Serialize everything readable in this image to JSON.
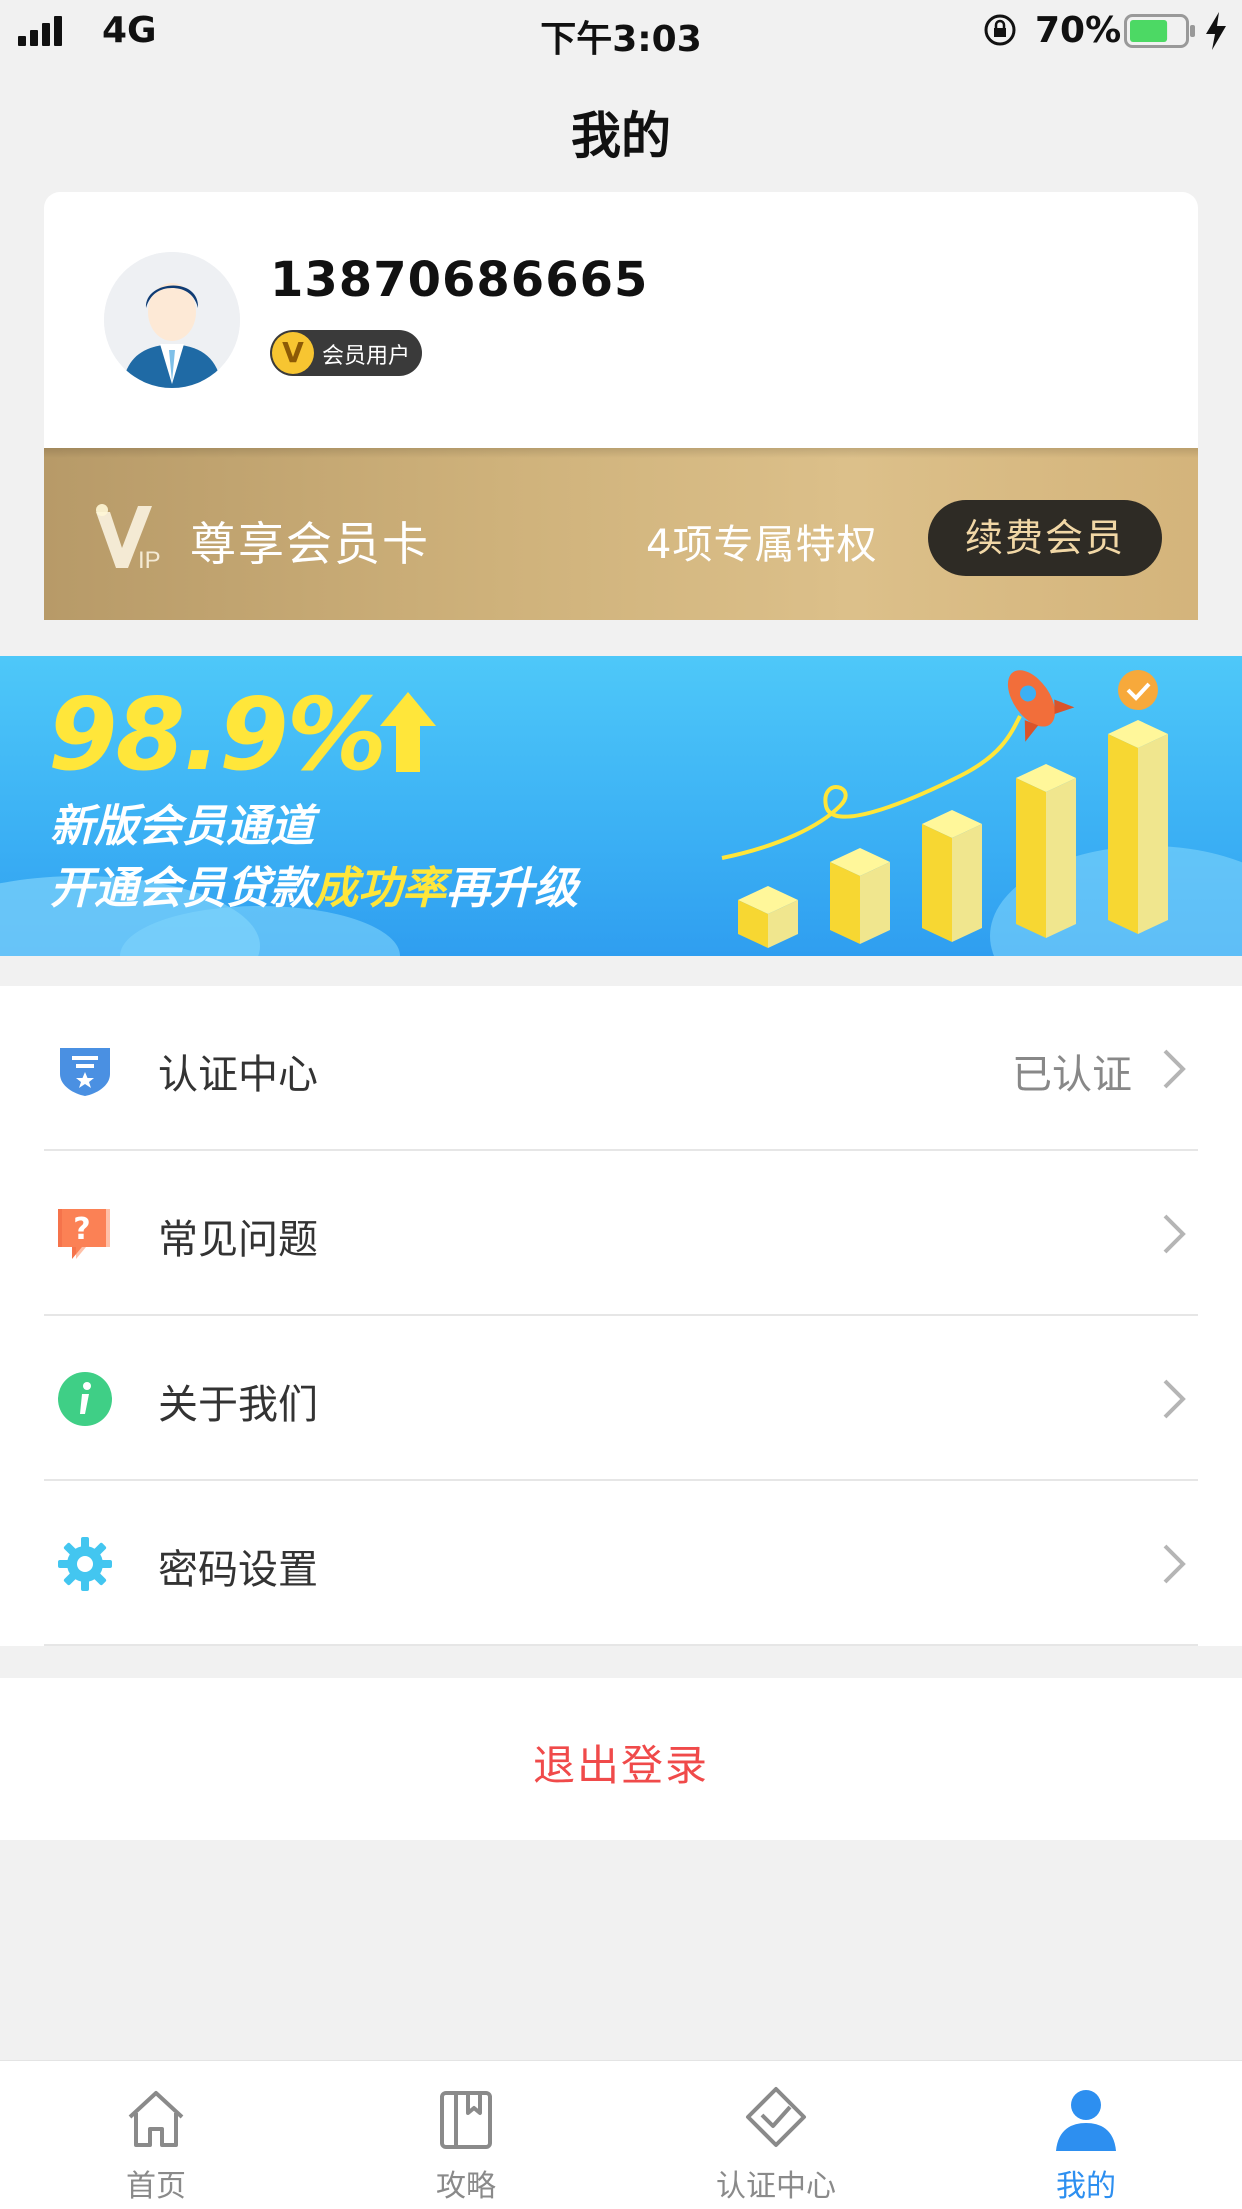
{
  "status_bar": {
    "network": "4G",
    "time": "下午3:03",
    "battery_percent": "70%",
    "battery_level": 0.7
  },
  "page": {
    "title": "我的"
  },
  "profile": {
    "phone": "13870686665",
    "badge_icon_letter": "V",
    "badge_label": "会员用户"
  },
  "vip_card": {
    "title": "尊享会员卡",
    "privileges": "4项专属特权",
    "renew_label": "续费会员"
  },
  "banner": {
    "percent": "98.9%",
    "line1": "新版会员通道",
    "line2_prefix": "开通会员贷款",
    "line2_highlight": "成功率",
    "line2_suffix": "再升级"
  },
  "menu": {
    "items": [
      {
        "label": "认证中心",
        "status": "已认证",
        "icon": "shield-icon",
        "color": "#4a90e2"
      },
      {
        "label": "常见问题",
        "status": "",
        "icon": "question-icon",
        "color": "#f5734b"
      },
      {
        "label": "关于我们",
        "status": "",
        "icon": "info-icon",
        "color": "#3fcf86"
      },
      {
        "label": "密码设置",
        "status": "",
        "icon": "gear-icon",
        "color": "#43c6f0"
      }
    ]
  },
  "logout": {
    "label": "退出登录"
  },
  "tabbar": {
    "tabs": [
      {
        "label": "首页",
        "icon": "home-icon"
      },
      {
        "label": "攻略",
        "icon": "book-icon"
      },
      {
        "label": "认证中心",
        "icon": "verify-icon"
      },
      {
        "label": "我的",
        "icon": "user-icon",
        "active": true
      }
    ]
  },
  "colors": {
    "accent": "#2d8ff0",
    "logout": "#f04a4a",
    "banner_highlight": "#ffe63a"
  }
}
